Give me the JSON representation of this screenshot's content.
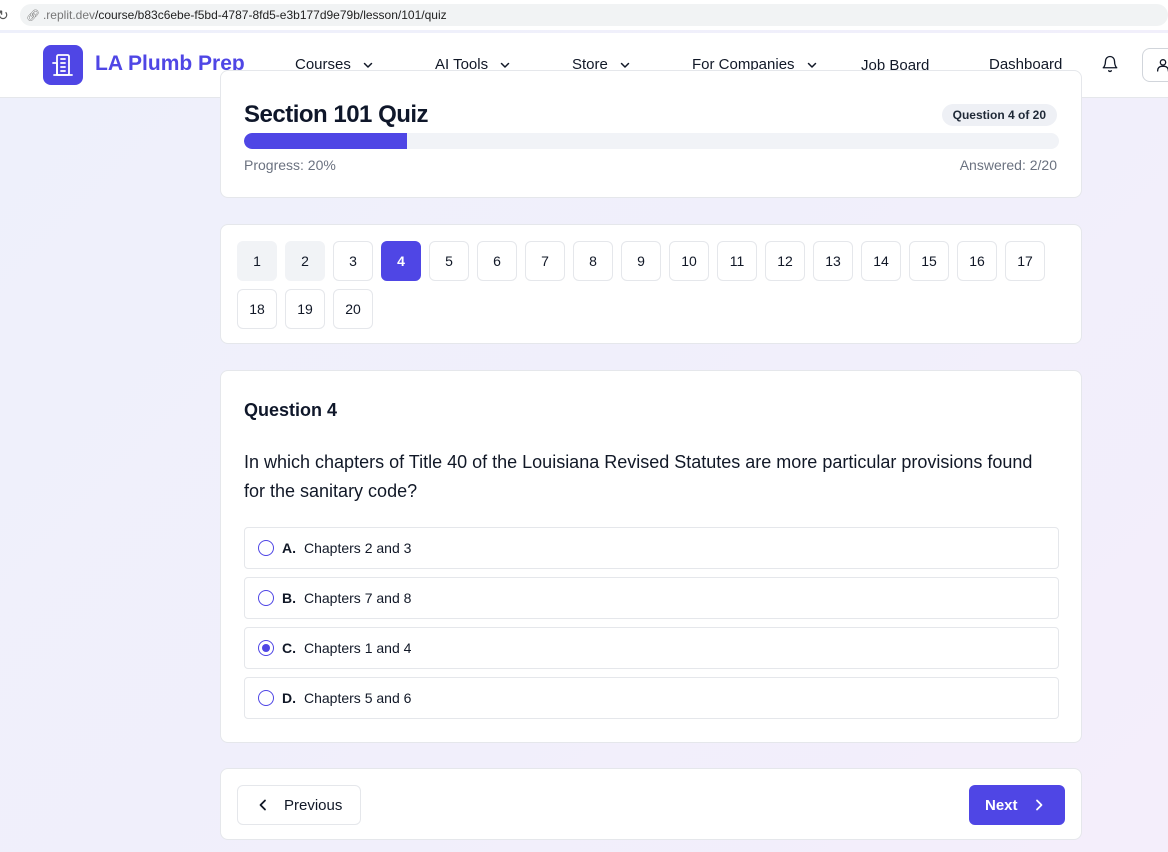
{
  "browser": {
    "url_host": ".replit.dev",
    "url_path": "/course/b83c6ebe-f5bd-4787-8fd5-e3b177d9e79b/lesson/101/quiz"
  },
  "nav": {
    "brand": "LA Plumb Prep",
    "items": [
      {
        "label": "Courses",
        "has_dropdown": true
      },
      {
        "label": "AI Tools",
        "has_dropdown": true
      },
      {
        "label": "Store",
        "has_dropdown": true
      },
      {
        "label": "For Companies",
        "has_dropdown": true
      },
      {
        "label": "Job Board",
        "has_dropdown": false
      },
      {
        "label": "Dashboard",
        "has_dropdown": false
      }
    ],
    "icons": [
      "bell-icon",
      "user-icon"
    ]
  },
  "quiz": {
    "title": "Section 101 Quiz",
    "badge": "Question 4 of 20",
    "progress_label": "Progress: 20%",
    "progress_fraction": 0.2,
    "answered_label": "Answered: 2/20"
  },
  "question_nav": {
    "numbers": [
      "1",
      "2",
      "3",
      "4",
      "5",
      "6",
      "7",
      "8",
      "9",
      "10",
      "11",
      "12",
      "13",
      "14",
      "15",
      "16",
      "17",
      "18",
      "19",
      "20"
    ],
    "current": "4",
    "answered": [
      "1",
      "2"
    ]
  },
  "question": {
    "heading": "Question 4",
    "text": "In which chapters of Title 40 of the Louisiana Revised Statutes are more particular provisions found for the sanitary code?",
    "options": [
      {
        "letter": "A.",
        "text": "Chapters 2 and 3",
        "selected": false
      },
      {
        "letter": "B.",
        "text": "Chapters 7 and 8",
        "selected": false
      },
      {
        "letter": "C.",
        "text": "Chapters 1 and 4",
        "selected": true
      },
      {
        "letter": "D.",
        "text": "Chapters 5 and 6",
        "selected": false
      }
    ]
  },
  "footer": {
    "previous_label": "Previous",
    "next_label": "Next"
  },
  "colors": {
    "accent": "#4f46e5",
    "muted_text": "#6b7280"
  }
}
